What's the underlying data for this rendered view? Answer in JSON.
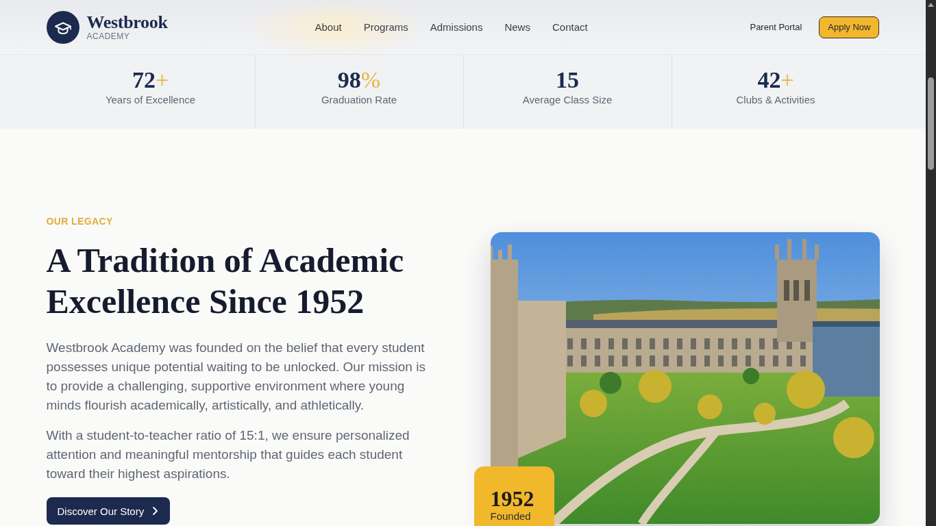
{
  "header": {
    "brand": {
      "name": "Westbrook",
      "tagline": "ACADEMY"
    },
    "nav": [
      "About",
      "Programs",
      "Admissions",
      "News",
      "Contact"
    ],
    "portal_link": "Parent Portal",
    "apply_button": "Apply Now"
  },
  "stats": [
    {
      "value": "72",
      "suffix": "+",
      "label": "Years of Excellence"
    },
    {
      "value": "98",
      "suffix": "%",
      "label": "Graduation Rate"
    },
    {
      "value": "15",
      "label": "Average Class Size"
    },
    {
      "value": "42",
      "suffix": "+",
      "label": "Clubs & Activities"
    }
  ],
  "legacy": {
    "eyebrow": "OUR LEGACY",
    "heading": "A Tradition of Academic Excellence Since 1952",
    "paragraphs": [
      "Westbrook Academy was founded on the belief that every student possesses unique potential waiting to be unlocked. Our mission is to provide a challenging, supportive environment where young minds flourish academically, artistically, and athletically.",
      "With a student-to-teacher ratio of 15:1, we ensure personalized attention and meaningful mentorship that guides each student toward their highest aspirations."
    ],
    "button": "Discover Our Story",
    "badge": {
      "year": "1952",
      "caption": "Founded"
    }
  }
}
